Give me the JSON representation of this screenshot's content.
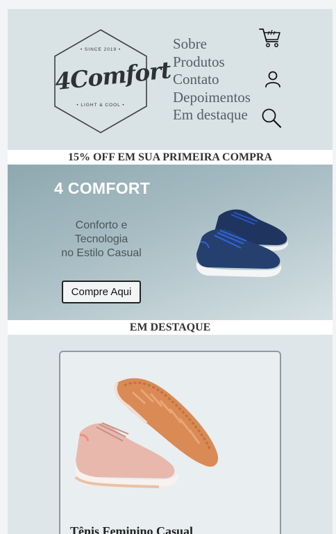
{
  "logo": {
    "since": "• SINCE 2019 •",
    "brand": "4Comfort",
    "tagline": "• LIGHT & COOL •"
  },
  "nav": {
    "items": [
      {
        "label": "Sobre"
      },
      {
        "label": "Produtos"
      },
      {
        "label": "Contato"
      },
      {
        "label": "Depoimentos"
      },
      {
        "label": "Em destaque"
      }
    ]
  },
  "icons": {
    "cart": "shopping-cart-icon",
    "user": "user-icon",
    "search": "search-icon"
  },
  "promo_banner": "15% OFF EM SUA PRIMEIRA COMPRA",
  "hero": {
    "title": "4 COMFORT",
    "subtitle_lines": [
      "Conforto e",
      "Tecnologia",
      "no Estilo Casual"
    ],
    "cta_label": "Compre Aqui"
  },
  "featured": {
    "heading": "EM DESTAQUE",
    "card_title": "Tênis Feminino Casual"
  },
  "colors": {
    "header_bg": "#d9e3e6",
    "hero_gradient_start": "#8ea8b0",
    "shoe_navy": "#223a66",
    "shoe_pink": "#e8b8ad"
  }
}
